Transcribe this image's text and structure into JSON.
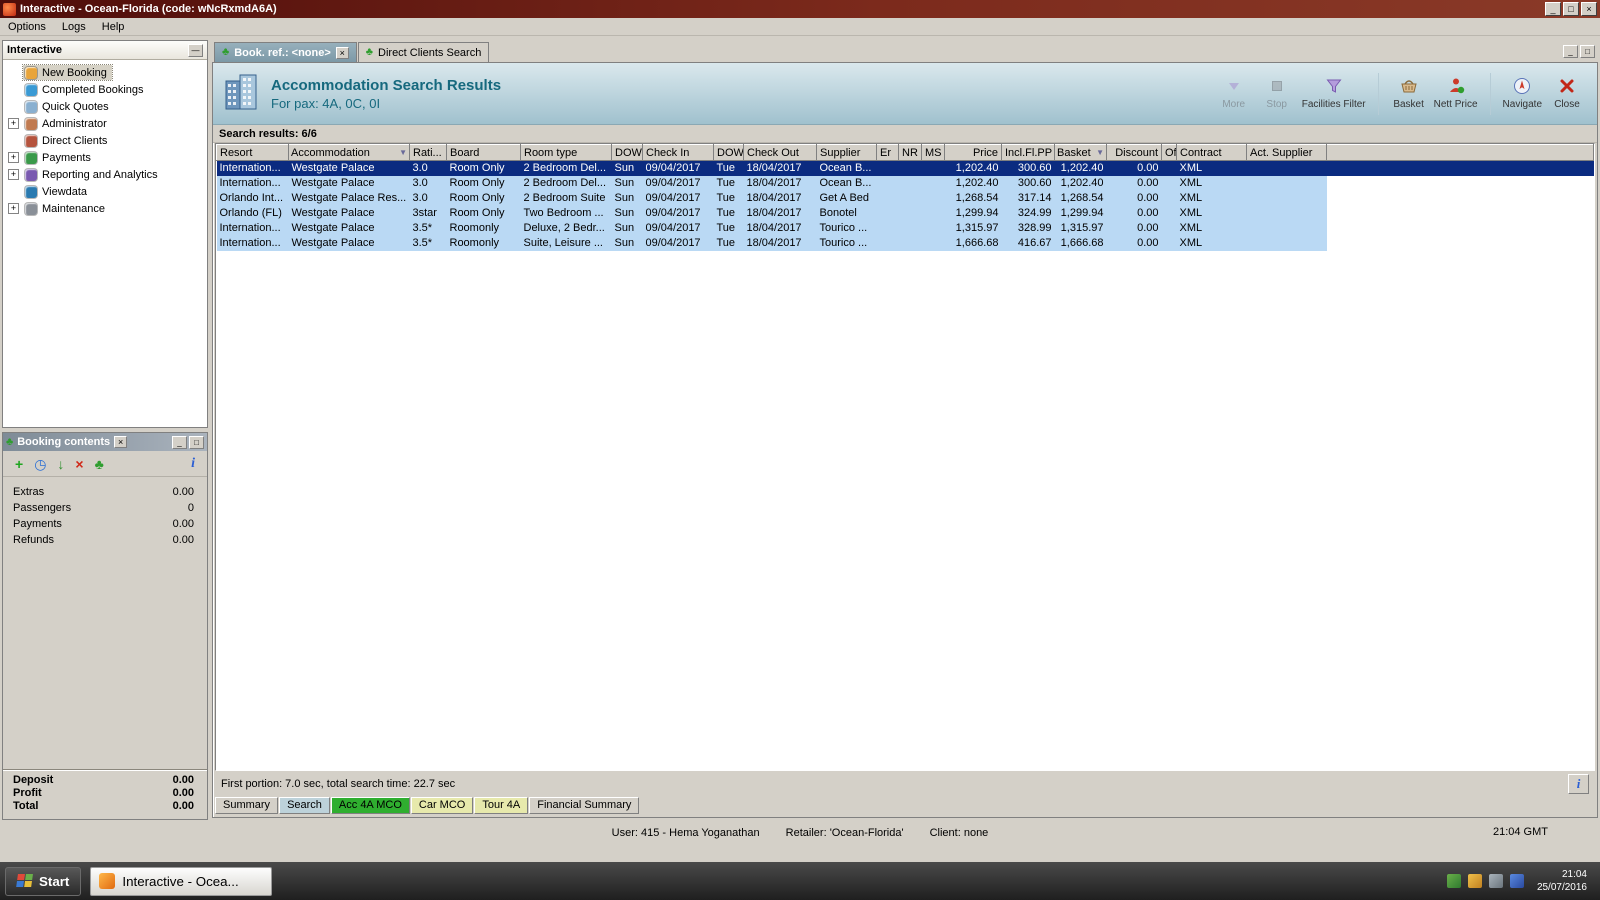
{
  "window": {
    "title": "Interactive - Ocean-Florida (code: wNcRxmdA6A)"
  },
  "icons": {
    "minimize": "_",
    "maximize": "□",
    "close": "×",
    "palm": "♣",
    "add": "+",
    "clock": "◷",
    "move_to_basket": "↓",
    "delete": "×",
    "info": "i",
    "funnel": "▼",
    "sort": "▼",
    "expander": "+",
    "collapse": "—"
  },
  "menu": {
    "items": [
      "Options",
      "Logs",
      "Help"
    ]
  },
  "sidebar": {
    "title": "Interactive",
    "items": [
      {
        "label": "New Booking",
        "state": "selected",
        "icon_color": "#e8a43a"
      },
      {
        "label": "Completed Bookings",
        "icon_color": "#3a9ad4"
      },
      {
        "label": "Quick Quotes",
        "icon_color": "#8ab0d0"
      },
      {
        "label": "Administrator",
        "expandable": true,
        "icon_color": "#c07a50"
      },
      {
        "label": "Direct Clients",
        "icon_color": "#b5543e"
      },
      {
        "label": "Payments",
        "expandable": true,
        "icon_color": "#3a9a4a"
      },
      {
        "label": "Reporting and Analytics",
        "expandable": true,
        "icon_color": "#7a5ab0"
      },
      {
        "label": "Viewdata",
        "icon_color": "#2a7ab0"
      },
      {
        "label": "Maintenance",
        "expandable": true,
        "icon_color": "#8a9098"
      }
    ]
  },
  "booking_contents": {
    "title": "Booking contents",
    "rows": [
      {
        "label": "Extras",
        "value": "0.00"
      },
      {
        "label": "Passengers",
        "value": "0"
      },
      {
        "label": "Payments",
        "value": "0.00"
      },
      {
        "label": "Refunds",
        "value": "0.00"
      }
    ],
    "totals": [
      {
        "label": "Deposit",
        "value": "0.00"
      },
      {
        "label": "Profit",
        "value": "0.00"
      },
      {
        "label": "Total",
        "value": "0.00"
      }
    ]
  },
  "tabs": {
    "active_label": "Book. ref.: <none>",
    "inactive_label": "Direct Clients Search"
  },
  "header": {
    "title": "Accommodation Search Results",
    "subtitle": "For pax: 4A, 0C, 0I",
    "tools": [
      {
        "label": "More",
        "disabled": true
      },
      {
        "label": "Stop",
        "disabled": true
      },
      {
        "label": "Facilities Filter"
      },
      {
        "label": "Basket"
      },
      {
        "label": "Nett Price"
      },
      {
        "label": "Navigate"
      },
      {
        "label": "Close"
      }
    ]
  },
  "results": {
    "summary": "Search results: 6/6",
    "columns": [
      "Resort",
      "Accommodation",
      "Rati...",
      "Board",
      "Room type",
      "DOW",
      "Check In",
      "DOW",
      "Check Out",
      "Supplier",
      "Er",
      "NR",
      "MS",
      "Price",
      "Incl.Fl.PP",
      "Basket",
      "Discount",
      "Of",
      "Contract",
      "Act. Supplier"
    ],
    "rows": [
      {
        "state": "selected",
        "resort": "Internation...",
        "accommodation": "Westgate Palace",
        "rating": "3.0",
        "board": "Room Only",
        "room_type": "2 Bedroom Del...",
        "dow_in": "Sun",
        "check_in": "09/04/2017",
        "dow_out": "Tue",
        "check_out": "18/04/2017",
        "supplier": "Ocean B...",
        "er": "",
        "nr": "",
        "ms": "",
        "price": "1,202.40",
        "incl_fl_pp": "300.60",
        "basket": "1,202.40",
        "discount": "0.00",
        "of": "",
        "contract": "XML",
        "act_supplier": ""
      },
      {
        "resort": "Internation...",
        "accommodation": "Westgate Palace",
        "rating": "3.0",
        "board": "Room Only",
        "room_type": "2 Bedroom Del...",
        "dow_in": "Sun",
        "check_in": "09/04/2017",
        "dow_out": "Tue",
        "check_out": "18/04/2017",
        "supplier": "Ocean B...",
        "price": "1,202.40",
        "incl_fl_pp": "300.60",
        "basket": "1,202.40",
        "discount": "0.00",
        "contract": "XML"
      },
      {
        "resort": "Orlando Int...",
        "accommodation": "Westgate Palace Res...",
        "rating": "3.0",
        "board": "Room Only",
        "room_type": "2 Bedroom Suite",
        "dow_in": "Sun",
        "check_in": "09/04/2017",
        "dow_out": "Tue",
        "check_out": "18/04/2017",
        "supplier": "Get A Bed",
        "price": "1,268.54",
        "incl_fl_pp": "317.14",
        "basket": "1,268.54",
        "discount": "0.00",
        "contract": "XML"
      },
      {
        "resort": "Orlando (FL)",
        "accommodation": "Westgate Palace",
        "rating": "3star",
        "board": "Room Only",
        "room_type": "Two Bedroom ...",
        "dow_in": "Sun",
        "check_in": "09/04/2017",
        "dow_out": "Tue",
        "check_out": "18/04/2017",
        "supplier": "Bonotel",
        "price": "1,299.94",
        "incl_fl_pp": "324.99",
        "basket": "1,299.94",
        "discount": "0.00",
        "contract": "XML"
      },
      {
        "resort": "Internation...",
        "accommodation": "Westgate Palace",
        "rating": "3.5*",
        "board": "Roomonly",
        "room_type": "Deluxe, 2 Bedr...",
        "dow_in": "Sun",
        "check_in": "09/04/2017",
        "dow_out": "Tue",
        "check_out": "18/04/2017",
        "supplier": "Tourico ...",
        "price": "1,315.97",
        "incl_fl_pp": "328.99",
        "basket": "1,315.97",
        "discount": "0.00",
        "contract": "XML"
      },
      {
        "resort": "Internation...",
        "accommodation": "Westgate Palace",
        "rating": "3.5*",
        "board": "Roomonly",
        "room_type": "Suite, Leisure ...",
        "dow_in": "Sun",
        "check_in": "09/04/2017",
        "dow_out": "Tue",
        "check_out": "18/04/2017",
        "supplier": "Tourico ...",
        "price": "1,666.68",
        "incl_fl_pp": "416.67",
        "basket": "1,666.68",
        "discount": "0.00",
        "contract": "XML"
      }
    ],
    "status": "First portion: 7.0 sec, total search time: 22.7 sec"
  },
  "bottom_tabs": [
    {
      "label": "Summary"
    },
    {
      "label": "Search",
      "style": "current"
    },
    {
      "label": "Acc 4A MCO",
      "style": "green"
    },
    {
      "label": "Car MCO",
      "style": "yellow"
    },
    {
      "label": "Tour 4A",
      "style": "yellow"
    },
    {
      "label": "Financial Summary"
    }
  ],
  "statusbar": {
    "user": "User: 415 - Hema Yoganathan",
    "retailer": "Retailer: 'Ocean-Florida'",
    "client": "Client: none",
    "time": "21:04 GMT"
  },
  "taskbar": {
    "start": "Start",
    "task": "Interactive - Ocea...",
    "clock_time": "21:04",
    "clock_date": "25/07/2016"
  }
}
